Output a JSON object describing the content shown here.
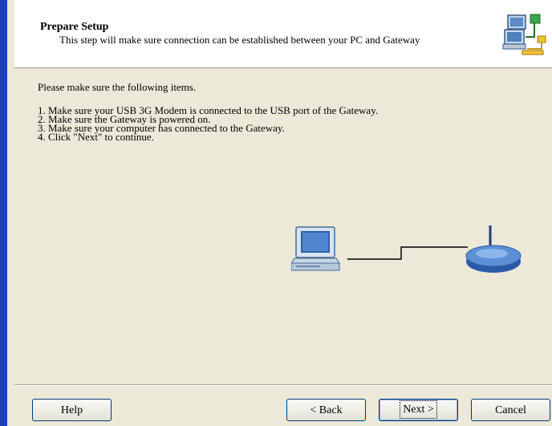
{
  "header": {
    "title": "Prepare Setup",
    "subtitle": "This step will make sure connection can be established between your PC and Gateway",
    "icon": "network-setup-icon"
  },
  "content": {
    "intro": "Please make sure the following items.",
    "steps": [
      "1. Make sure your USB 3G Modem is connected to the USB port of the Gateway.",
      "2. Make sure the Gateway is powered on.",
      "3. Make sure your computer has connected to the Gateway.",
      "4. Click \"Next\" to continue."
    ]
  },
  "diagram": {
    "left_icon": "computer-icon",
    "right_icon": "router-icon"
  },
  "buttons": {
    "help": "Help",
    "back": "< Back",
    "next": "Next >",
    "cancel": "Cancel"
  },
  "colors": {
    "window_border": "#1d3fb0",
    "dialog_background": "#ece9d8",
    "button_border": "#003c74"
  }
}
